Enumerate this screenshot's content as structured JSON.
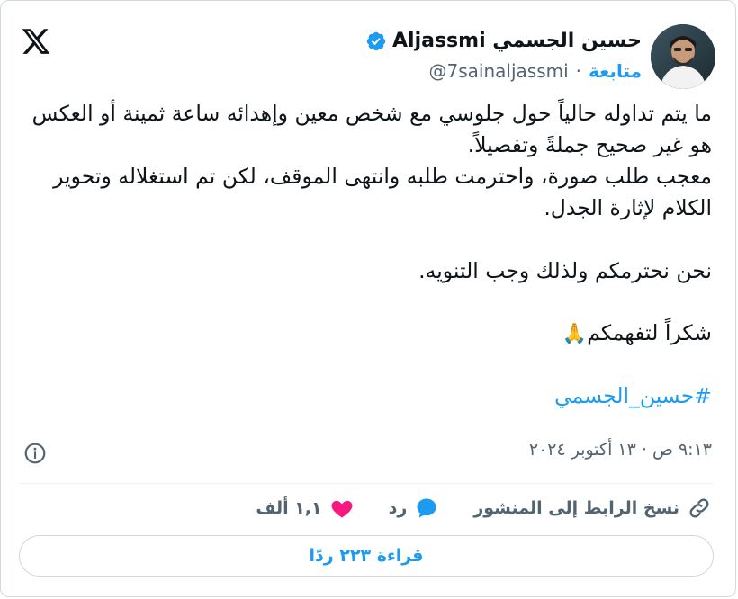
{
  "header": {
    "display_name": "حسين الجسمي Aljassmi",
    "handle": "@7sainaljassmi",
    "separator": "·",
    "follow_label": "متابعة",
    "logo_icon": "x-logo-icon",
    "verified_icon": "verified-badge-icon"
  },
  "tweet": {
    "line1": "ما يتم تداوله حالياً حول جلوسي مع شخص معين وإهدائه ساعة ثمينة أو العكس هو غير صحيح جملةً وتفصيلاً.",
    "line2": "معجب طلب صورة، واحترمت طلبه وانتهى الموقف، لكن تم استغلاله وتحوير الكلام لإثارة الجدل.",
    "line3": "نحن نحترمكم ولذلك وجب التنويه.",
    "line4": "شكراً لتفهمكم",
    "emoji": "🙏",
    "hashtag": "#حسين_الجسمي"
  },
  "meta": {
    "timestamp": "٩:١٣ ص · ١٣ أكتوبر ٢٠٢٤",
    "info_icon": "info-icon"
  },
  "actions": {
    "likes_count": "١,١ ألف",
    "reply_label": "رد",
    "copy_link_label": "نسخ الرابط إلى المنشور",
    "heart_color": "#f91880",
    "reply_color": "#1d9bf0"
  },
  "footer": {
    "read_replies_label": "قراءة ٢٢٣ ردًا"
  }
}
